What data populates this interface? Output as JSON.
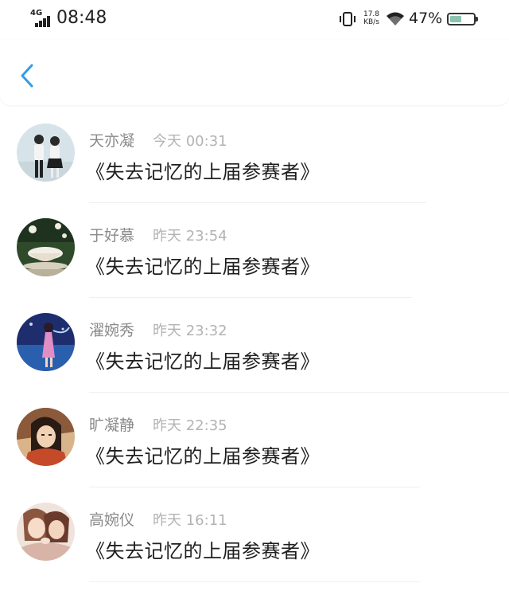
{
  "status_bar": {
    "network": "4G",
    "time": "08:48",
    "speed_value": "17.8",
    "speed_unit": "KB/s",
    "battery_percent": "47%",
    "battery_level": 0.47
  },
  "header": {
    "back_icon": "chevron-left-icon",
    "accent_color": "#2f9ee8"
  },
  "comments": [
    {
      "name": "天亦凝",
      "time": "今天 00:31",
      "text": "《失去记忆的上届参赛者》"
    },
    {
      "name": "于好慕",
      "time": "昨天 23:54",
      "text": "《失去记忆的上届参赛者》"
    },
    {
      "name": "濯婉秀",
      "time": "昨天 23:32",
      "text": "《失去记忆的上届参赛者》"
    },
    {
      "name": "旷凝静",
      "time": "昨天 22:35",
      "text": "《失去记忆的上届参赛者》"
    },
    {
      "name": "高婉仪",
      "time": "昨天 16:11",
      "text": "《失去记忆的上届参赛者》"
    }
  ]
}
